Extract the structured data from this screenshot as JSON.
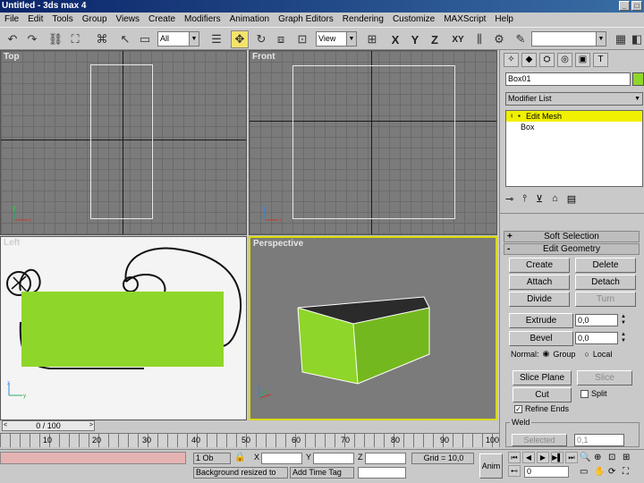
{
  "window": {
    "title": "Untitled - 3ds max 4"
  },
  "menu": [
    "File",
    "Edit",
    "Tools",
    "Group",
    "Views",
    "Create",
    "Modifiers",
    "Animation",
    "Graph Editors",
    "Rendering",
    "Customize",
    "MAXScript",
    "Help"
  ],
  "toolbar": {
    "selection_filter": "All",
    "ref_coord": "View",
    "axis_x": "X",
    "axis_y": "Y",
    "axis_z": "Z",
    "axis_xy": "XY"
  },
  "viewports": {
    "top": "Top",
    "front": "Front",
    "left": "Left",
    "perspective": "Perspective"
  },
  "command_panel": {
    "object_name": "Box01",
    "modifier_list": "Modifier List",
    "stack": [
      {
        "label": "Edit Mesh",
        "selected": true
      },
      {
        "label": "Box",
        "selected": false
      }
    ],
    "rollouts": {
      "soft_selection": {
        "sign": "+",
        "label": "Soft Selection"
      },
      "edit_geometry": {
        "sign": "-",
        "label": "Edit Geometry"
      }
    },
    "buttons": {
      "create": "Create",
      "delete": "Delete",
      "attach": "Attach",
      "detach": "Detach",
      "divide": "Divide",
      "turn": "Turn",
      "extrude": "Extrude",
      "bevel": "Bevel",
      "slice_plane": "Slice Plane",
      "slice": "Slice",
      "cut": "Cut",
      "selected": "Selected"
    },
    "extrude_value": "0,0",
    "bevel_value": "0,0",
    "normal_label": "Normal:",
    "normal_group": "Group",
    "normal_local": "Local",
    "split_label": "Split",
    "refine_ends_label": "Refine Ends",
    "weld_label": "Weld",
    "weld_value": "0,1"
  },
  "timeline": {
    "frame": "0 / 100",
    "ticks": [
      "10",
      "20",
      "30",
      "40",
      "50",
      "60",
      "70",
      "80",
      "90",
      "100"
    ]
  },
  "status": {
    "selection": "1 Ob",
    "x_label": "X",
    "y_label": "Y",
    "z_label": "Z",
    "grid": "Grid = 10,0",
    "prompt": "Background resized to",
    "add_time_tag": "Add Time Tag",
    "anim": "Anim",
    "current_frame": "0"
  },
  "colors": {
    "object_green": "#8fd62a",
    "stack_highlight": "#f0f000",
    "active_viewport": "#d9d900"
  }
}
